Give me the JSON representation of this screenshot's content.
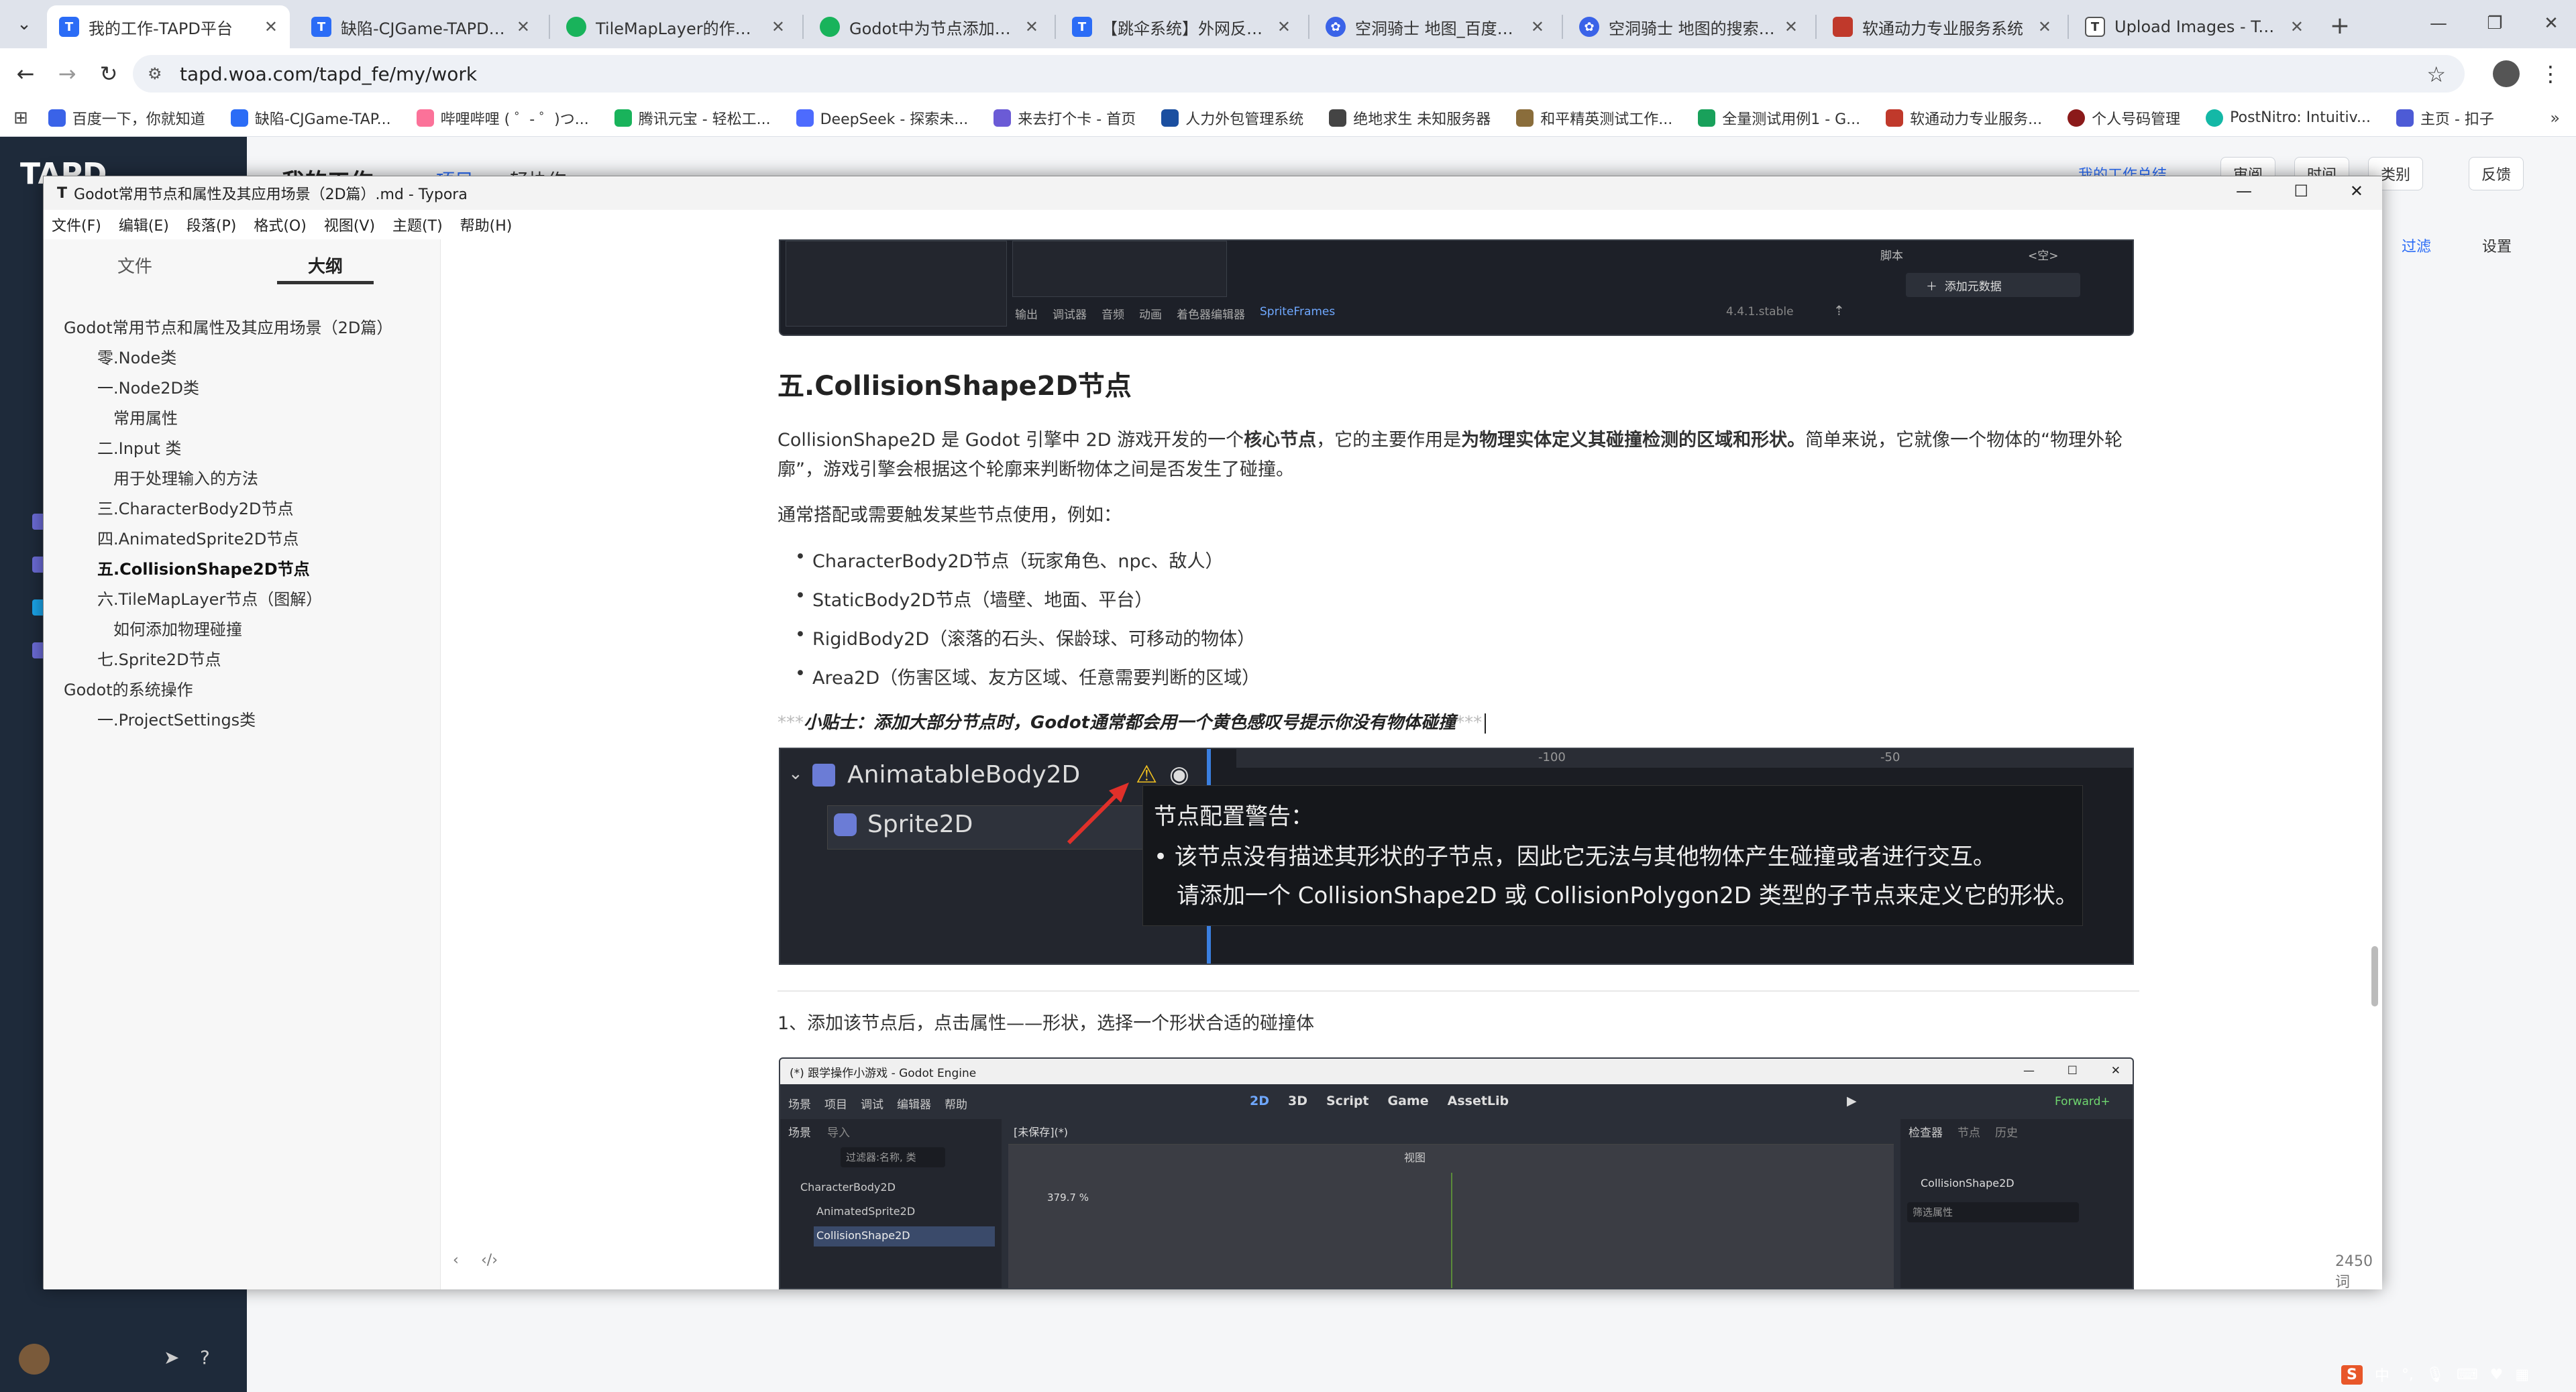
{
  "browser": {
    "tabs": [
      {
        "title": "我的工作-TAPD平台",
        "color": "#2b6cf6",
        "active": true
      },
      {
        "title": "缺陷-CJGame-TAPD平台",
        "color": "#2b6cf6"
      },
      {
        "title": "TileMapLayer的作用及应用",
        "color": "#19b35b"
      },
      {
        "title": "Godot中为节点添加交互节点",
        "color": "#19b35b"
      },
      {
        "title": "【跳伞系统】外网反馈-人",
        "color": "#2b6cf6"
      },
      {
        "title": "空洞骑士 地图_百度搜索",
        "color": "#3a63e8"
      },
      {
        "title": "空洞骑士 地图的搜索结果",
        "color": "#3a63e8"
      },
      {
        "title": "软通动力专业服务系统",
        "color": "#c0392b"
      },
      {
        "title": "Upload Images - Typora",
        "color": "#555555"
      }
    ],
    "url": "tapd.woa.com/tapd_fe/my/work",
    "bookmarks": [
      {
        "label": "百度一下，你就知道",
        "color": "#3a63e8"
      },
      {
        "label": "缺陷-CJGame-TAP...",
        "color": "#2b6cf6"
      },
      {
        "label": "哔哩哔哩 ( ゜- ゜)つ...",
        "color": "#fb7299"
      },
      {
        "label": "腾讯元宝 - 轻松工...",
        "color": "#19b35b"
      },
      {
        "label": "DeepSeek - 探索未...",
        "color": "#4d6bfe"
      },
      {
        "label": "来去打个卡 - 首页",
        "color": "#6b5bd6"
      },
      {
        "label": "人力外包管理系统",
        "color": "#1b4fa0"
      },
      {
        "label": "绝地求生 未知服务器",
        "color": "#444444"
      },
      {
        "label": "和平精英测试工作...",
        "color": "#8a6d3b"
      },
      {
        "label": "全量测试用例1 - G...",
        "color": "#19a15b"
      },
      {
        "label": "软通动力专业服务...",
        "color": "#c0392b"
      },
      {
        "label": "个人号码管理",
        "color": "#8b1a1a"
      },
      {
        "label": "PostNitro: Intuitiv...",
        "color": "#14b8a6"
      },
      {
        "label": "主页 - 扣子",
        "color": "#4d5bd6"
      }
    ]
  },
  "tapd": {
    "logo": "TAPD",
    "page_title": "我的工作",
    "tabs": [
      "项目",
      "轻协作"
    ],
    "top_buttons": [
      "我的工作总结",
      "审阅",
      "时间",
      "类别",
      "反馈"
    ],
    "filter": "过滤",
    "settings": "设置"
  },
  "typora": {
    "window_title": "Godot常用节点和属性及其应用场景（2D篇）.md - Typora",
    "menus": [
      "文件(F)",
      "编辑(E)",
      "段落(P)",
      "格式(O)",
      "视图(V)",
      "主题(T)",
      "帮助(H)"
    ],
    "side_tabs": [
      "文件",
      "大纲"
    ],
    "outline": [
      {
        "text": "Godot常用节点和属性及其应用场景（2D篇）",
        "level": 0
      },
      {
        "text": "零.Node类",
        "level": 1
      },
      {
        "text": "一.Node2D类",
        "level": 1
      },
      {
        "text": "常用属性",
        "level": 2
      },
      {
        "text": "二.Input 类",
        "level": 1
      },
      {
        "text": "用于处理输入的方法",
        "level": 2
      },
      {
        "text": "三.CharacterBody2D节点",
        "level": 1
      },
      {
        "text": "四.AnimatedSprite2D节点",
        "level": 1
      },
      {
        "text": "五.CollisionShape2D节点",
        "level": 1,
        "active": true
      },
      {
        "text": "六.TileMapLayer节点（图解）",
        "level": 1
      },
      {
        "text": "如何添加物理碰撞",
        "level": 2
      },
      {
        "text": "七.Sprite2D节点",
        "level": 1
      },
      {
        "text": "Godot的系统操作",
        "level": 0
      },
      {
        "text": "一.ProjectSettings类",
        "level": 1
      }
    ],
    "word_count": "2450 词",
    "doc": {
      "top_image": {
        "tabs": [
          "输出",
          "调试器",
          "音频",
          "动画",
          "着色器编辑器",
          "SpriteFrames"
        ],
        "version": "4.4.1.stable",
        "script_label": "脚本",
        "script_value": "<空>",
        "add_meta": "添加元数据"
      },
      "heading": "五.CollisionShape2D节点",
      "para1_a": "CollisionShape2D 是 Godot 引擎中 2D 游戏开发的一个",
      "para1_b": "核心节点",
      "para1_c": "，它的主要作用是",
      "para1_d": "为物理实体定义其碰撞检测的区域和形状。",
      "para1_e": "简单来说，它就像一个物体的“物理外轮廓”，游戏引擎会根据这个轮廓来判断物体之间是否发生了碰撞。",
      "para2": "通常搭配或需要触发某些节点使用，例如：",
      "list": [
        "CharacterBody2D节点（玩家角色、npc、敌人）",
        "StaticBody2D节点（墙壁、地面、平台）",
        "RigidBody2D（滚落的石头、保龄球、可移动的物体）",
        "Area2D（伤害区域、友方区域、任意需要判断的区域）"
      ],
      "tip_marks_open": "***",
      "tip": "小贴士：添加大部分节点时，Godot通常都会用一个黄色感叹号提示你没有物体碰撞",
      "tip_marks_close": "***",
      "warn_image": {
        "node1": "AnimatableBody2D",
        "node2": "Sprite2D",
        "ruler1": "-100",
        "ruler2": "-50",
        "warn_title": "节点配置警告：",
        "warn_line1": "• 该节点没有描述其形状的子节点，因此它无法与其他物体产生碰撞或者进行交互。",
        "warn_line2": "请添加一个 CollisionShape2D 或 CollisionPolygon2D 类型的子节点来定义它的形状。"
      },
      "step1": "1、添加该节点后，点击属性——形状，选择一个形状合适的碰撞体",
      "godot_image": {
        "title": "(*) 跟学操作小游戏 - Godot Engine",
        "menus": [
          "场景",
          "项目",
          "调试",
          "编辑器",
          "帮助"
        ],
        "modes": [
          "2D",
          "3D",
          "Script",
          "Game",
          "AssetLib"
        ],
        "renderer": "Forward+",
        "left_tabs": [
          "场景",
          "导入"
        ],
        "filter_placeholder": "过滤器:名称, 类",
        "scene_tab": "[未保存](*)",
        "view_menu": "视图",
        "zoom": "379.7 %",
        "right_tabs": [
          "检查器",
          "节点",
          "历史"
        ],
        "inspector_node": "CollisionShape2D",
        "filter_props": "筛选属性",
        "tree": [
          "CharacterBody2D",
          "AnimatedSprite2D",
          "CollisionShape2D"
        ]
      }
    }
  }
}
